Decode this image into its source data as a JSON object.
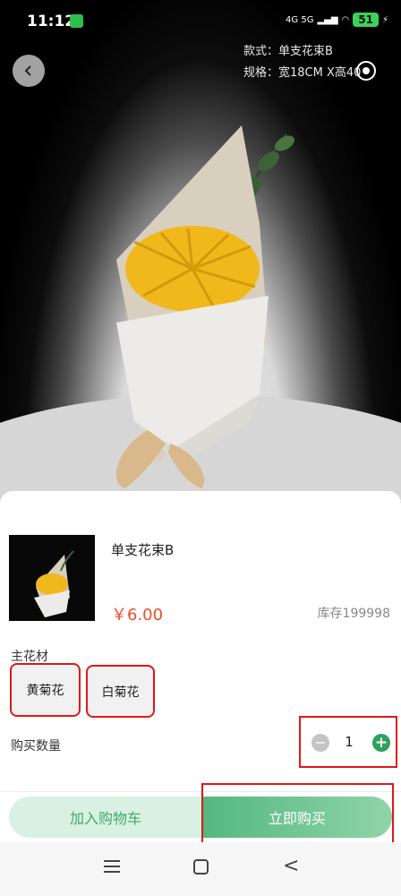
{
  "status_bar": {
    "time": "11:12",
    "network": "4G 5G",
    "battery": "51"
  },
  "specs": {
    "style_line": "款式：单支花束B",
    "size_line": "规格：宽18CM X高40"
  },
  "product": {
    "name": "单支花束B",
    "price": "￥6.00",
    "stock": "库存199998"
  },
  "material": {
    "label": "主花材",
    "options": [
      "黄菊花",
      "白菊花"
    ]
  },
  "quantity": {
    "label": "购买数量",
    "value": "1",
    "minus_symbol": "−",
    "plus_symbol": "+"
  },
  "actions": {
    "add_to_cart": "加入购物车",
    "buy_now": "立即购买"
  },
  "colors": {
    "price": "#e8512a",
    "accent_green": "#2ea05f",
    "highlight_red": "#e01818"
  }
}
